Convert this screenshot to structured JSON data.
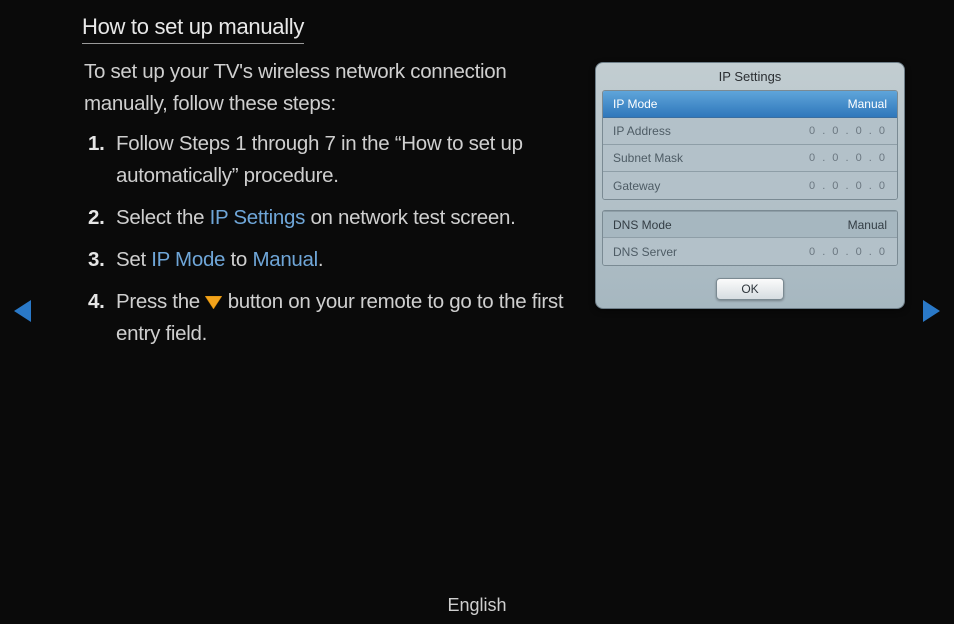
{
  "title": "How to set up manually",
  "intro": "To set up your TV's wireless network connection manually, follow these steps:",
  "steps": {
    "s1": {
      "num": "1.",
      "text": "Follow Steps 1 through 7 in the “How to set up automatically” procedure."
    },
    "s2": {
      "num": "2.",
      "pre": "Select the ",
      "hl": "IP Settings",
      "post": " on network test screen."
    },
    "s3": {
      "num": "3.",
      "a": "Set ",
      "hl1": "IP Mode",
      "b": " to ",
      "hl2": "Manual",
      "c": "."
    },
    "s4": {
      "num": "4.",
      "pre": "Press the ",
      "post": " button on your remote to go to the first entry field."
    }
  },
  "panel": {
    "title": "IP Settings",
    "ipmode": {
      "label": "IP Mode",
      "value": "Manual"
    },
    "ipaddr": {
      "label": "IP Address",
      "value": "0 . 0 . 0 . 0"
    },
    "subnet": {
      "label": "Subnet Mask",
      "value": "0 . 0 . 0 . 0"
    },
    "gateway": {
      "label": "Gateway",
      "value": "0 . 0 . 0 . 0"
    },
    "dnsmode": {
      "label": "DNS Mode",
      "value": "Manual"
    },
    "dnsserver": {
      "label": "DNS Server",
      "value": "0 . 0 . 0 . 0"
    },
    "ok": "OK"
  },
  "footer": {
    "lang": "English"
  }
}
